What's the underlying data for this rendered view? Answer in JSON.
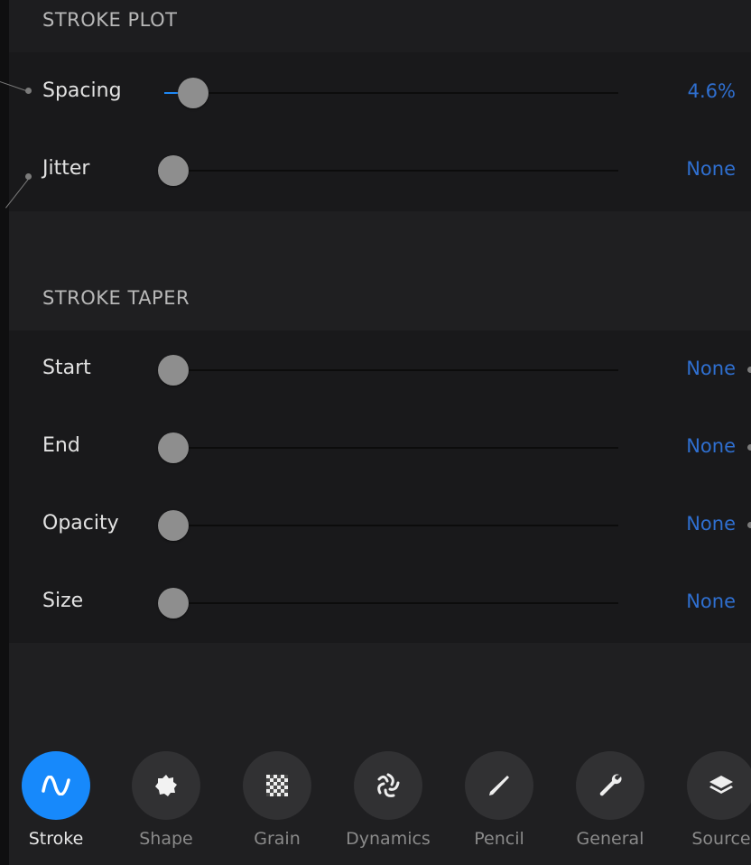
{
  "sections": {
    "stroke_plot": {
      "title": "STROKE PLOT",
      "rows": [
        {
          "label": "Spacing",
          "value": "4.6%",
          "level": 0.046
        },
        {
          "label": "Jitter",
          "value": "None",
          "level": 0
        }
      ]
    },
    "stroke_taper": {
      "title": "STROKE TAPER",
      "rows": [
        {
          "label": "Start",
          "value": "None",
          "level": 0
        },
        {
          "label": "End",
          "value": "None",
          "level": 0
        },
        {
          "label": "Opacity",
          "value": "None",
          "level": 0
        },
        {
          "label": "Size",
          "value": "None",
          "level": 0
        }
      ]
    }
  },
  "tabs": [
    {
      "label": "Stroke",
      "icon": "stroke-wave-icon",
      "active": true
    },
    {
      "label": "Shape",
      "icon": "shape-blob-icon",
      "active": false
    },
    {
      "label": "Grain",
      "icon": "grain-texture-icon",
      "active": false
    },
    {
      "label": "Dynamics",
      "icon": "dynamics-swirl-icon",
      "active": false
    },
    {
      "label": "Pencil",
      "icon": "pencil-icon",
      "active": false
    },
    {
      "label": "General",
      "icon": "wrench-icon",
      "active": false
    },
    {
      "label": "Source",
      "icon": "layers-icon",
      "active": false
    }
  ],
  "colors": {
    "accent": "#1789fb",
    "value_text": "#2f6fd0",
    "background": "#1f1f21"
  }
}
